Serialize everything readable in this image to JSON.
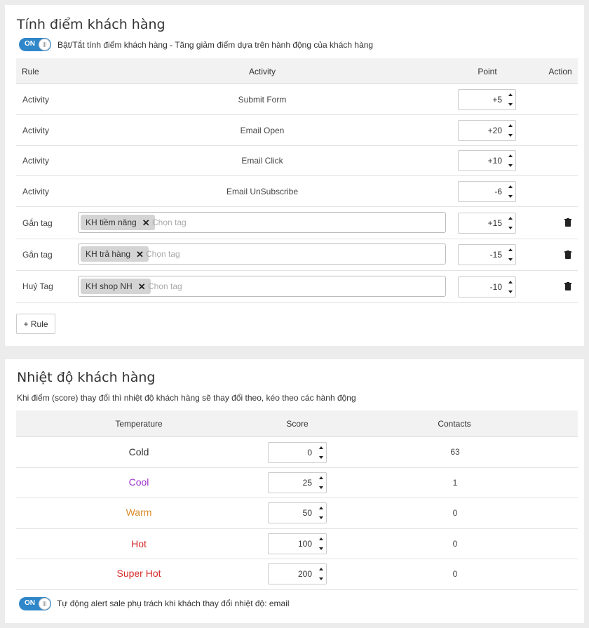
{
  "scoring": {
    "title": "Tính điểm khách hàng",
    "toggle": {
      "state": "ON",
      "label": "Bật/Tắt tính điểm khách hàng - Tăng giảm điểm dựa trên hành động của khách hàng"
    },
    "headers": {
      "rule": "Rule",
      "activity": "Activity",
      "point": "Point",
      "action": "Action"
    },
    "activity_rows": [
      {
        "rule": "Activity",
        "activity": "Submit Form",
        "point": "+5"
      },
      {
        "rule": "Activity",
        "activity": "Email Open",
        "point": "+20"
      },
      {
        "rule": "Activity",
        "activity": "Email Click",
        "point": "+10"
      },
      {
        "rule": "Activity",
        "activity": "Email UnSubscribe",
        "point": "-6"
      }
    ],
    "tag_rows": [
      {
        "rule": "Gắn tag",
        "tag": "KH tiềm năng",
        "placeholder": "Chọn tag",
        "point": "+15",
        "action_icon": "trash-icon"
      },
      {
        "rule": "Gắn tag",
        "tag": "KH trả hàng",
        "placeholder": "Chọn tag",
        "point": "-15",
        "action_icon": "trash-icon"
      },
      {
        "rule": "Huỷ Tag",
        "tag": "KH shop NH",
        "placeholder": "Chọn tag",
        "point": "-10",
        "action_icon": "trash-icon"
      }
    ],
    "tag_remove_glyph": "✕",
    "add_rule_label": "+ Rule"
  },
  "temperature": {
    "title": "Nhiệt độ khách hàng",
    "description": "Khi điểm (score) thay đổi thì nhiệt độ khách hàng sẽ thay đổi theo, kéo theo các hành động",
    "headers": {
      "temperature": "Temperature",
      "score": "Score",
      "contacts": "Contacts"
    },
    "rows": [
      {
        "name": "Cold",
        "color": "#333333",
        "score": "0",
        "contacts": "63"
      },
      {
        "name": "Cool",
        "color": "#9b30c8",
        "score": "25",
        "contacts": "1"
      },
      {
        "name": "Warm",
        "color": "#d98a2b",
        "score": "50",
        "contacts": "0"
      },
      {
        "name": "Hot",
        "color": "#d62a2a",
        "score": "100",
        "contacts": "0"
      },
      {
        "name": "Super Hot",
        "color": "#d62a2a",
        "score": "200",
        "contacts": "0"
      }
    ],
    "toggle": {
      "state": "ON",
      "label": "Tự động alert sale phụ trách khi khách thay đổi nhiệt độ: email"
    }
  },
  "colors": {
    "toggle_on": "#2f86c9",
    "header_bg": "#f2f2f2",
    "page_bg": "#ececec"
  }
}
